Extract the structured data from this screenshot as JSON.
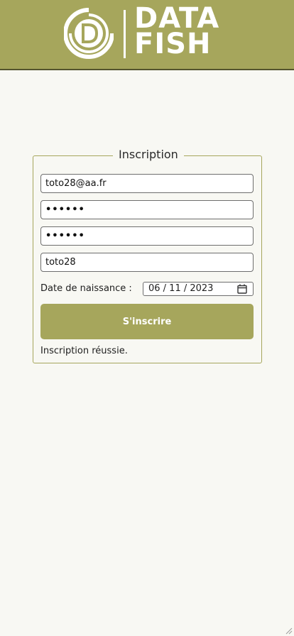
{
  "brand": {
    "logo_icon": "d-circle-logo-icon",
    "line1": "DATA",
    "line2": "FISH",
    "color": "#a6a65c"
  },
  "form": {
    "legend": "Inscription",
    "email_value": "toto28@aa.fr",
    "password_value": "••••••",
    "password_confirm_value": "••••••",
    "username_value": "toto28",
    "dob_label": "Date de naissance :",
    "dob_value": "06 / 11 / 2023",
    "dob_icon": "calendar-icon",
    "submit_label": "S'inscrire",
    "status_message": "Inscription réussie."
  }
}
